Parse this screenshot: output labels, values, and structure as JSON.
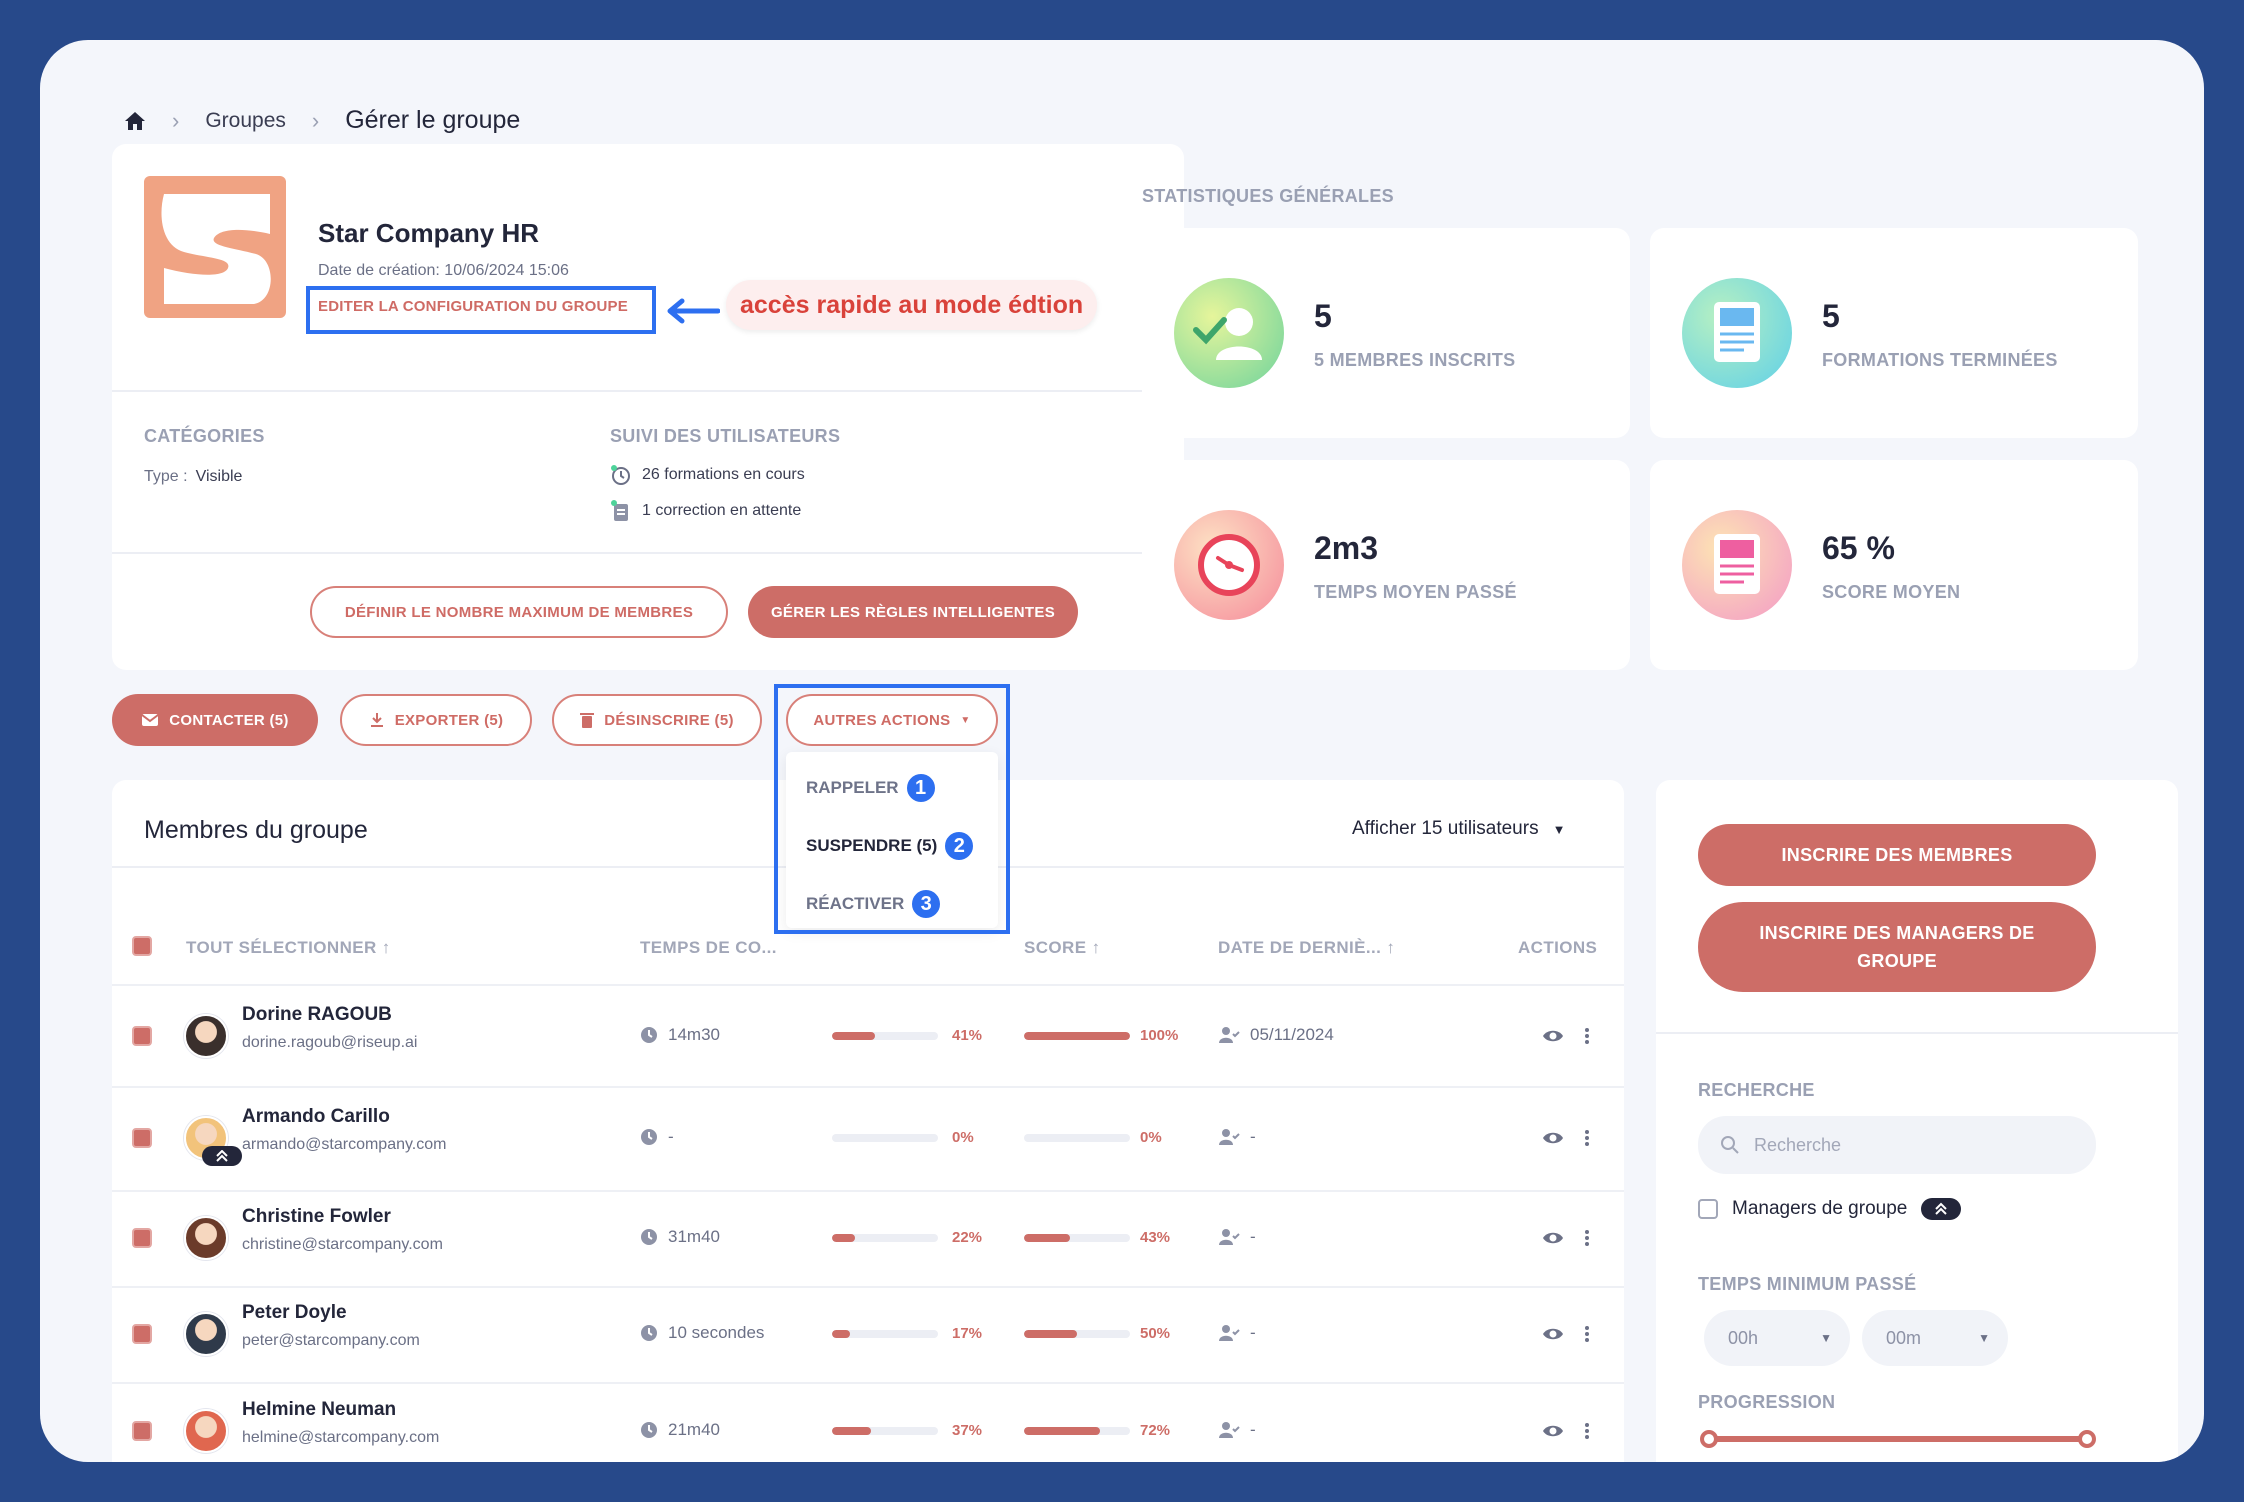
{
  "breadcrumb": {
    "items": [
      "Groupes"
    ],
    "current": "Gérer le groupe"
  },
  "group": {
    "name": "Star Company HR",
    "created": "Date de création: 10/06/2024 15:06",
    "edit_link": "EDITER LA CONFIGURATION DU GROUPE",
    "callout": "accès rapide au mode édtion",
    "categories_title": "CATÉGORIES",
    "type_label": "Type :",
    "type_value": "Visible",
    "tracking_title": "SUIVI DES UTILISATEURS",
    "tracking_1": "26 formations en cours",
    "tracking_2": "1 correction en attente",
    "btn_max": "DÉFINIR LE NOMBRE MAXIMUM DE MEMBRES",
    "btn_rules": "GÉRER LES RÈGLES INTELLIGENTES"
  },
  "stats": {
    "title": "STATISTIQUES GÉNÉRALES",
    "items": [
      {
        "value": "5",
        "label": "5 MEMBRES INSCRITS"
      },
      {
        "value": "5",
        "label": "FORMATIONS TERMINÉES"
      },
      {
        "value": "2m3",
        "label": "TEMPS MOYEN PASSÉ"
      },
      {
        "value": "65 %",
        "label": "SCORE MOYEN"
      }
    ]
  },
  "actions": {
    "contact": "CONTACTER (5)",
    "export": "EXPORTER (5)",
    "unsubscribe": "DÉSINSCRIRE (5)",
    "other": "AUTRES ACTIONS",
    "menu": [
      {
        "label": "RAPPELER",
        "badge": "1"
      },
      {
        "label": "SUSPENDRE (5)",
        "badge": "2"
      },
      {
        "label": "RÉACTIVER",
        "badge": "3"
      }
    ]
  },
  "members": {
    "title": "Membres du groupe",
    "show_select": "Afficher 15 utilisateurs",
    "headers": {
      "select_all": "TOUT SÉLECTIONNER",
      "time": "TEMPS DE CO...",
      "score": "SCORE",
      "last_date": "DATE DE DERNIÈ...",
      "actions": "ACTIONS"
    },
    "rows": [
      {
        "name": "Dorine RAGOUB",
        "email": "dorine.ragoub@riseup.ai",
        "time": "14m30",
        "progress": 41,
        "progress_label": "41%",
        "score": 100,
        "score_label": "100%",
        "date": "05/11/2024"
      },
      {
        "name": "Armando Carillo",
        "email": "armando@starcompany.com",
        "time": "-",
        "progress": 0,
        "progress_label": "0%",
        "score": 0,
        "score_label": "0%",
        "date": "-"
      },
      {
        "name": "Christine Fowler",
        "email": "christine@starcompany.com",
        "time": "31m40",
        "progress": 22,
        "progress_label": "22%",
        "score": 43,
        "score_label": "43%",
        "date": "-"
      },
      {
        "name": "Peter Doyle",
        "email": "peter@starcompany.com",
        "time": "10 secondes",
        "progress": 17,
        "progress_label": "17%",
        "score": 50,
        "score_label": "50%",
        "date": "-"
      },
      {
        "name": "Helmine Neuman",
        "email": "helmine@starcompany.com",
        "time": "21m40",
        "progress": 37,
        "progress_label": "37%",
        "score": 72,
        "score_label": "72%",
        "date": "-"
      }
    ]
  },
  "sidebar": {
    "btn_members": "INSCRIRE DES MEMBRES",
    "btn_managers": "INSCRIRE DES MANAGERS DE GROUPE",
    "search_title": "RECHERCHE",
    "search_placeholder": "Recherche",
    "managers_label": "Managers de groupe",
    "min_time_title": "TEMPS MINIMUM PASSÉ",
    "hours": "00h",
    "minutes": "00m",
    "progress_title": "PROGRESSION"
  },
  "colors": {
    "accent": "#cd6d67",
    "highlight": "#2d6ff0",
    "background": "#27498a"
  }
}
